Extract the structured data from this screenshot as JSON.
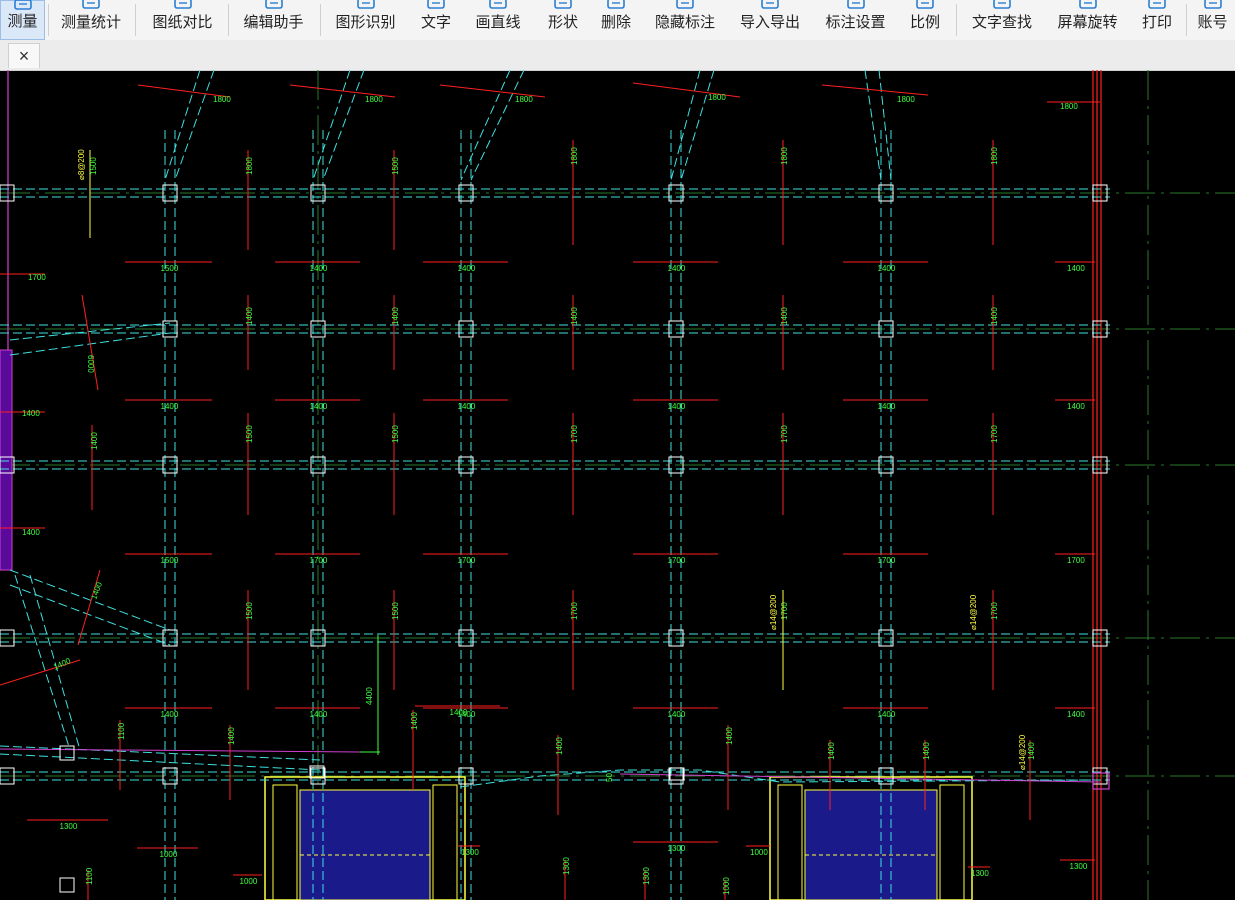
{
  "toolbar": {
    "items": [
      {
        "label": "测量",
        "icon": "ruler-icon"
      },
      {
        "label": "测量统计",
        "icon": "measure-stats-icon"
      },
      {
        "label": "图纸对比",
        "icon": "compare-icon"
      },
      {
        "label": "编辑助手",
        "icon": "edit-assistant-icon"
      },
      {
        "label": "图形识别",
        "icon": "shape-recognition-icon"
      },
      {
        "label": "文字",
        "icon": "text-icon"
      },
      {
        "label": "画直线",
        "icon": "line-icon"
      },
      {
        "label": "形状",
        "icon": "shape-icon"
      },
      {
        "label": "删除",
        "icon": "eraser-icon"
      },
      {
        "label": "隐藏标注",
        "icon": "hide-annotation-icon"
      },
      {
        "label": "导入导出",
        "icon": "import-export-icon"
      },
      {
        "label": "标注设置",
        "icon": "annotation-settings-icon"
      },
      {
        "label": "比例",
        "icon": "scale-icon"
      },
      {
        "label": "文字查找",
        "icon": "text-search-icon"
      },
      {
        "label": "屏幕旋转",
        "icon": "rotate-screen-icon"
      },
      {
        "label": "打印",
        "icon": "print-icon"
      },
      {
        "label": "账号",
        "icon": "account-icon"
      }
    ]
  },
  "tab": {
    "close_glyph": "×"
  },
  "drawing": {
    "top_dims": [
      "1800",
      "1800",
      "1800",
      "1800",
      "1800",
      "1800"
    ],
    "dim_1400": "1400",
    "dim_1500": "1500",
    "dim_1700": "1700",
    "dim_1300": "1300",
    "dim_1000": "1000",
    "dim_1100": "1100",
    "dim_4400": "4400",
    "dim_6000": "6000",
    "dim_50": "50",
    "rebar_a": "⌀8@200",
    "rebar_b": "⌀14@200",
    "colors": {
      "grid": "#3fe0e0",
      "dim_red": "#ff2020",
      "dim_text": "#40ff40",
      "yellow": "#ffff40",
      "magenta": "#d040d0",
      "axis": "#2a7a2a",
      "blue_fill": "#1a1a8a"
    }
  }
}
